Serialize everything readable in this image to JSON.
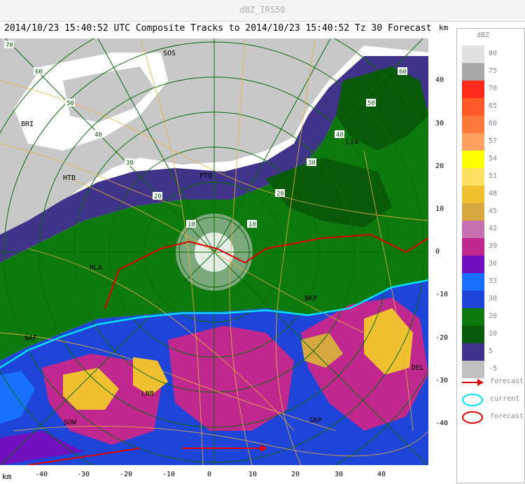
{
  "window": {
    "title": "dBZ_IRS50"
  },
  "header": {
    "text": "2014/10/23 15:40:52 UTC Composite Tracks to 2014/10/23 15:40:52 Tz 30 Forecast"
  },
  "axes": {
    "unit": "km",
    "x_ticks": [
      "-40",
      "-30",
      "-20",
      "-10",
      "0",
      "10",
      "20",
      "30",
      "40"
    ],
    "y_ticks": [
      "40",
      "30",
      "20",
      "10",
      "0",
      "-10",
      "-20",
      "-30",
      "-40"
    ]
  },
  "rings": {
    "labels": [
      "10",
      "20",
      "30",
      "40",
      "50",
      "60",
      "70"
    ]
  },
  "stations": [
    {
      "id": "SOS"
    },
    {
      "id": "BRI"
    },
    {
      "id": "HTB"
    },
    {
      "id": "PTQ"
    },
    {
      "id": "LIA"
    },
    {
      "id": "HLA"
    },
    {
      "id": "BKP"
    },
    {
      "id": "NAF"
    },
    {
      "id": "DEL"
    },
    {
      "id": "LNB"
    },
    {
      "id": "SOW"
    },
    {
      "id": "SKP"
    }
  ],
  "legend": {
    "title": "dBZ",
    "levels": [
      {
        "label": "80",
        "color": "#e0e0e0"
      },
      {
        "label": "75",
        "color": "#a8a8a8"
      },
      {
        "label": "70",
        "color": "#ff2a1a"
      },
      {
        "label": "65",
        "color": "#ff5a28"
      },
      {
        "label": "60",
        "color": "#ff7a3a"
      },
      {
        "label": "57",
        "color": "#ffa060"
      },
      {
        "label": "54",
        "color": "#ffff00"
      },
      {
        "label": "51",
        "color": "#ffe060"
      },
      {
        "label": "48",
        "color": "#f0c030"
      },
      {
        "label": "45",
        "color": "#d8a840"
      },
      {
        "label": "42",
        "color": "#c870b0"
      },
      {
        "label": "39",
        "color": "#c02890"
      },
      {
        "label": "36",
        "color": "#7010c0"
      },
      {
        "label": "33",
        "color": "#1870ff"
      },
      {
        "label": "30",
        "color": "#1e44d8"
      },
      {
        "label": "20",
        "color": "#0c7a0c"
      },
      {
        "label": "10",
        "color": "#085a08"
      },
      {
        "label": "5",
        "color": "#40348a"
      },
      {
        "label": "-5",
        "color": "#c0c0c0"
      }
    ],
    "keys": [
      {
        "label": "forecast",
        "kind": "arrow",
        "color": "#e00000"
      },
      {
        "label": "current",
        "kind": "ellipse",
        "color": "#00e0ff"
      },
      {
        "label": "forecast",
        "kind": "ellipse",
        "color": "#e00000"
      }
    ]
  }
}
